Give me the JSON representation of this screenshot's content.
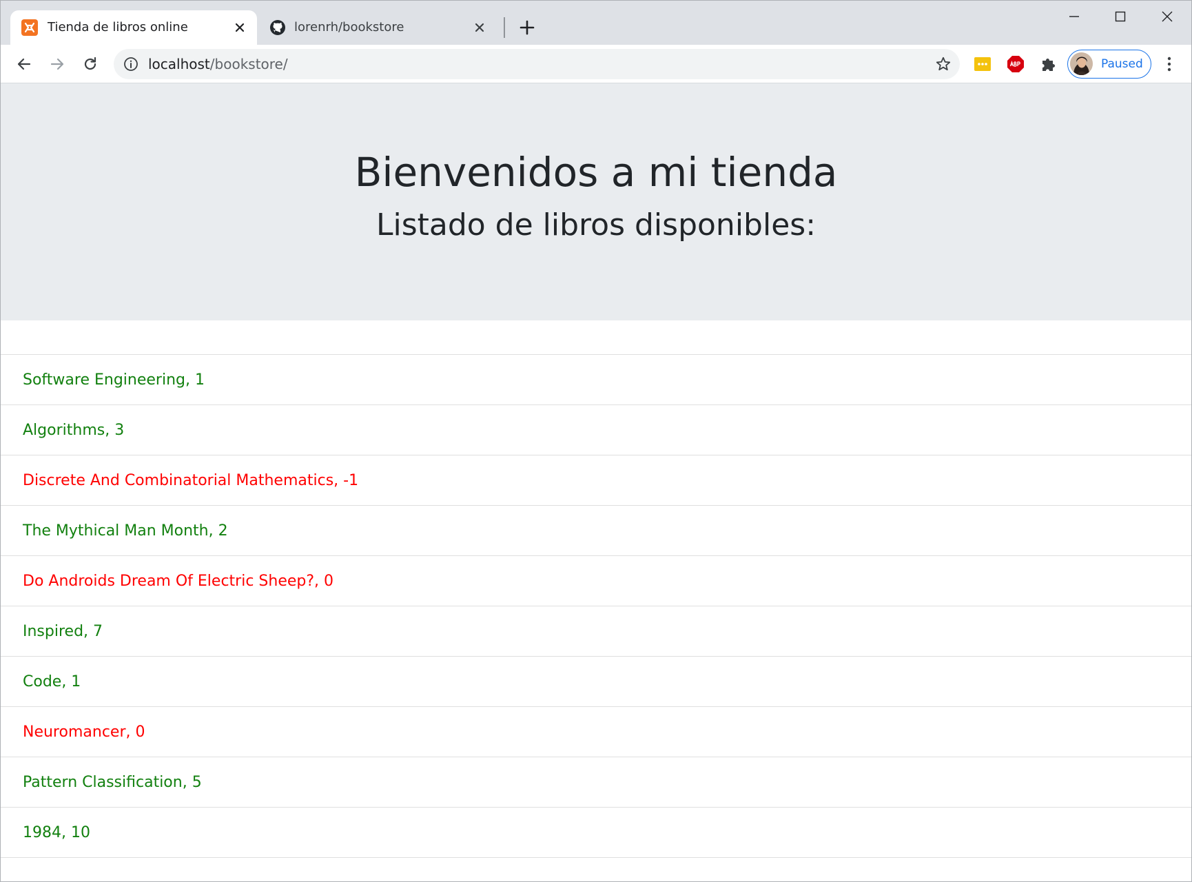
{
  "browser": {
    "tabs": [
      {
        "title": "Tienda de libros online",
        "active": true,
        "favicon": "xampp-icon"
      },
      {
        "title": "lorenrh/bookstore",
        "active": false,
        "favicon": "github-icon"
      }
    ],
    "address": {
      "host": "localhost",
      "path": "/bookstore/"
    },
    "profile_label": "Paused",
    "accent_color": "#1a73e8"
  },
  "page": {
    "title": "Bienvenidos a mi tienda",
    "subtitle": "Listado de libros disponibles:",
    "colors": {
      "in_stock": "#12800f",
      "out_of_stock": "#ff0000",
      "jumbotron_bg": "#e9ecef"
    },
    "books": [
      {
        "text": "Software Engineering, 1",
        "status": "in-stock"
      },
      {
        "text": "Algorithms, 3",
        "status": "in-stock"
      },
      {
        "text": "Discrete And Combinatorial Mathematics, -1",
        "status": "out-stock"
      },
      {
        "text": "The Mythical Man Month, 2",
        "status": "in-stock"
      },
      {
        "text": "Do Androids Dream Of Electric Sheep?, 0",
        "status": "out-stock"
      },
      {
        "text": "Inspired, 7",
        "status": "in-stock"
      },
      {
        "text": "Code, 1",
        "status": "in-stock"
      },
      {
        "text": "Neuromancer, 0",
        "status": "out-stock"
      },
      {
        "text": "Pattern Classification, 5",
        "status": "in-stock"
      },
      {
        "text": "1984, 10",
        "status": "in-stock"
      }
    ]
  }
}
